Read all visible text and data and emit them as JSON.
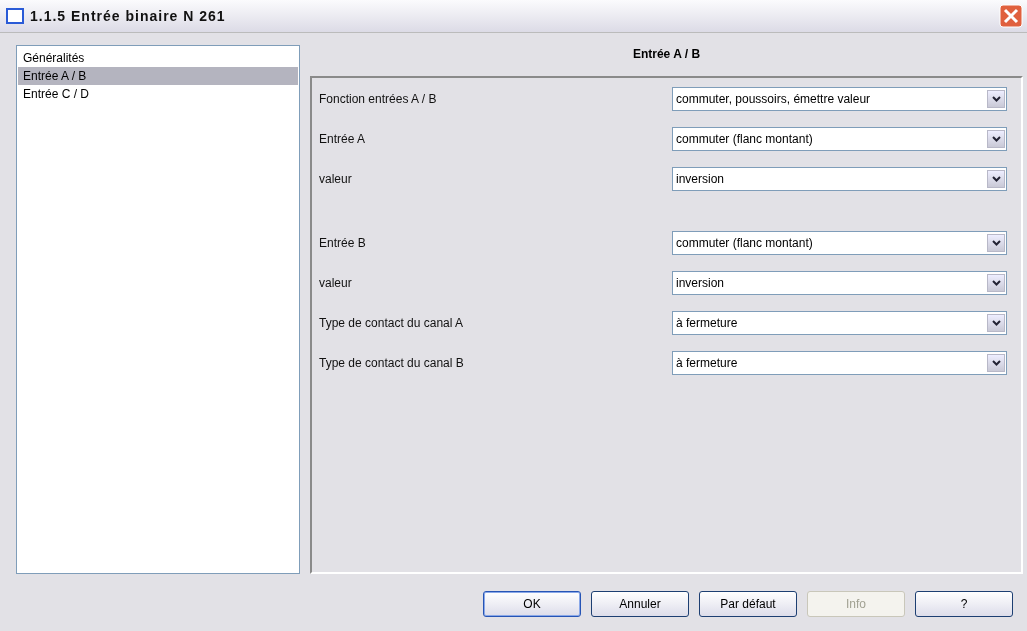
{
  "window": {
    "title": "1.1.5 Entrée binaire N 261"
  },
  "sidebar": {
    "items": [
      {
        "label": "Généralités",
        "selected": false
      },
      {
        "label": "Entrée A / B",
        "selected": true
      },
      {
        "label": "Entrée C / D",
        "selected": false
      }
    ]
  },
  "panel": {
    "title": "Entrée A / B",
    "groups": [
      [
        {
          "label": "Fonction entrées A / B",
          "value": "commuter, poussoirs, émettre valeur"
        },
        {
          "label": "Entrée A",
          "value": "commuter (flanc montant)"
        },
        {
          "label": "valeur",
          "value": "inversion"
        }
      ],
      [
        {
          "label": "Entrée B",
          "value": "commuter (flanc montant)"
        },
        {
          "label": "valeur",
          "value": "inversion"
        },
        {
          "label": "Type de contact du canal A",
          "value": "à fermeture"
        },
        {
          "label": "Type de contact du canal B",
          "value": "à fermeture"
        }
      ]
    ]
  },
  "buttons": [
    {
      "label": "OK",
      "disabled": false,
      "default": true
    },
    {
      "label": "Annuler",
      "disabled": false,
      "default": false
    },
    {
      "label": "Par défaut",
      "disabled": false,
      "default": false
    },
    {
      "label": "Info",
      "disabled": true,
      "default": false
    },
    {
      "label": "?",
      "disabled": false,
      "default": false
    }
  ]
}
